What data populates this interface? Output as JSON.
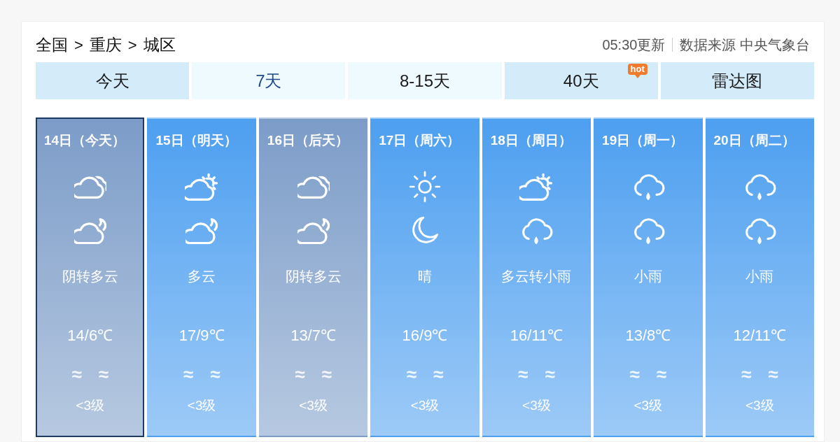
{
  "breadcrumb": [
    {
      "kind": "link",
      "text": "全国"
    },
    {
      "kind": "separator",
      "text": ">"
    },
    {
      "kind": "link",
      "text": "重庆"
    },
    {
      "kind": "separator",
      "text": ">"
    },
    {
      "kind": "link",
      "text": "城区"
    }
  ],
  "update_time": "05:30更新",
  "source": "数据来源 中央气象台",
  "tabs": [
    {
      "label": "今天",
      "selected": false,
      "color": "#d4ebfa"
    },
    {
      "label": "7天",
      "selected": true,
      "color": "#effafe"
    },
    {
      "label": "8-15天",
      "selected": false,
      "color": "#effafe"
    },
    {
      "label": "40天",
      "selected": false,
      "color": "#d4ebfa",
      "badge": "hot"
    },
    {
      "label": "雷达图",
      "selected": false,
      "color": "#d4ebfa"
    }
  ],
  "days": [
    {
      "date": "14日（今天）",
      "selected": true,
      "color": "#7c9cc8",
      "icons": [
        {
          "kind": "overcast"
        },
        {
          "kind": "cloudy-night"
        }
      ],
      "weather": "阴转多云",
      "temperature": "14/6℃",
      "wind": [
        "≈",
        "≈"
      ],
      "wind_level": "<3级"
    },
    {
      "date": "15日（明天）",
      "selected": false,
      "color": "#4d9ff0",
      "icons": [
        {
          "kind": "partly-cloudy"
        },
        {
          "kind": "cloudy-night"
        }
      ],
      "weather": "多云",
      "temperature": "17/9℃",
      "wind": [
        "≈",
        "≈"
      ],
      "wind_level": "<3级"
    },
    {
      "date": "16日（后天）",
      "selected": false,
      "color": "#7c9cc8",
      "icons": [
        {
          "kind": "overcast"
        },
        {
          "kind": "cloudy-night"
        }
      ],
      "weather": "阴转多云",
      "temperature": "13/7℃",
      "wind": [
        "≈",
        "≈"
      ],
      "wind_level": "<3级"
    },
    {
      "date": "17日（周六）",
      "selected": false,
      "color": "#4d9ff0",
      "icons": [
        {
          "kind": "sunny"
        },
        {
          "kind": "clear-night"
        }
      ],
      "weather": "晴",
      "temperature": "16/9℃",
      "wind": [
        "≈",
        "≈"
      ],
      "wind_level": "<3级"
    },
    {
      "date": "18日（周日）",
      "selected": false,
      "color": "#4d9ff0",
      "icons": [
        {
          "kind": "partly-cloudy"
        },
        {
          "kind": "rain"
        }
      ],
      "weather": "多云转小雨",
      "temperature": "16/11℃",
      "wind": [
        "≈",
        "≈"
      ],
      "wind_level": "<3级"
    },
    {
      "date": "19日（周一）",
      "selected": false,
      "color": "#4d9ff0",
      "icons": [
        {
          "kind": "rain"
        },
        {
          "kind": "rain"
        }
      ],
      "weather": "小雨",
      "temperature": "13/8℃",
      "wind": [
        "≈",
        "≈"
      ],
      "wind_level": "<3级"
    },
    {
      "date": "20日（周二）",
      "selected": false,
      "color": "#4d9ff0",
      "icons": [
        {
          "kind": "rain"
        },
        {
          "kind": "rain"
        }
      ],
      "weather": "小雨",
      "temperature": "12/11℃",
      "wind": [
        "≈",
        "≈"
      ],
      "wind_level": "<3级"
    }
  ]
}
